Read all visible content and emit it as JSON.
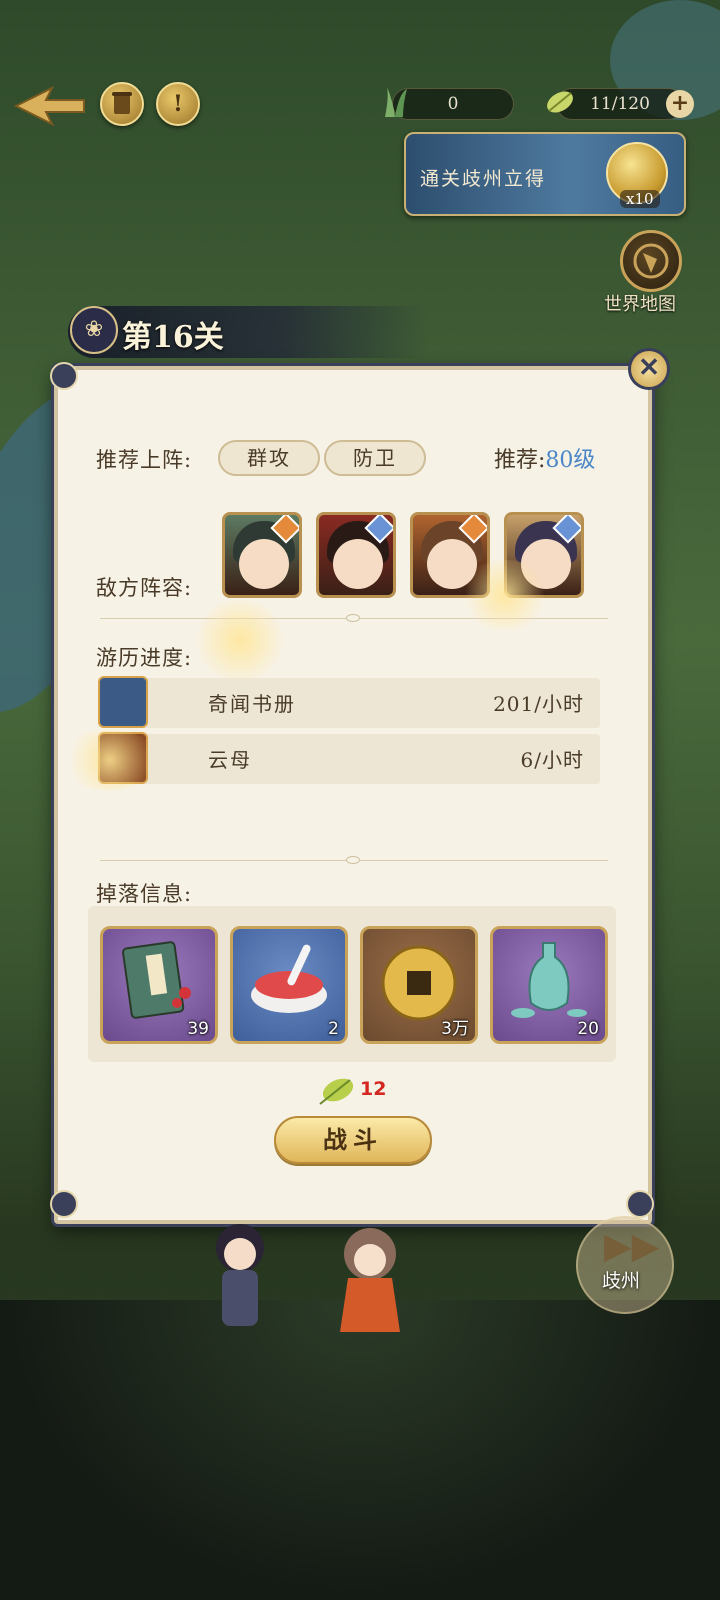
{
  "topbar": {
    "res1_value": "0",
    "res2_value": "11/120",
    "plus": "+",
    "help_icon": "!"
  },
  "reward": {
    "text": "通关歧州立得",
    "count": "x10"
  },
  "world_map": {
    "label": "世界地图"
  },
  "stage": {
    "title": "第16关"
  },
  "panel": {
    "recommend_label": "推荐上阵:",
    "tags": [
      "群攻",
      "防卫"
    ],
    "recommend_level_prefix": "推荐:",
    "recommend_level_value": "80级",
    "enemy_label": "敌方阵容:",
    "heroes": [
      {
        "icon": "hero-green-robe",
        "badge": "moon",
        "badge_color": "#e58a3a",
        "hair": "#2f3a34",
        "bg": "#5c7a62"
      },
      {
        "icon": "hero-red-crown",
        "badge": "star",
        "badge_color": "#6a93d6",
        "hair": "#2a1a16",
        "bg": "#8a2a22"
      },
      {
        "icon": "hero-brown-hair",
        "badge": "moon",
        "badge_color": "#e58a3a",
        "hair": "#6b4328",
        "bg": "#b0642f"
      },
      {
        "icon": "hero-violet-hair",
        "badge": "star",
        "badge_color": "#6a93d6",
        "hair": "#3a3450",
        "bg": "#c7a16a"
      }
    ],
    "progress_label": "游历进度:",
    "progress": [
      {
        "name": "奇闻书册",
        "rate": "201/小时",
        "icon": "book-icon",
        "bg": "#3b5a86"
      },
      {
        "name": "云母",
        "rate": "6/小时",
        "icon": "mica-icon",
        "bg": "#8a4a24"
      }
    ],
    "drops_label": "掉落信息:",
    "drops": [
      {
        "icon": "book-bundle-icon",
        "count": "39",
        "bg": "#6a4a8c"
      },
      {
        "icon": "red-paste-bowl-icon",
        "count": "2",
        "bg": "#3f5f9a"
      },
      {
        "icon": "copper-coin-icon",
        "count": "3万",
        "bg": "#6c4a2e"
      },
      {
        "icon": "jade-vase-icon",
        "count": "20",
        "bg": "#6a4a8c"
      }
    ],
    "stamina_cost": "12",
    "fight_label": "战斗"
  },
  "next_area": {
    "label": "歧州"
  }
}
